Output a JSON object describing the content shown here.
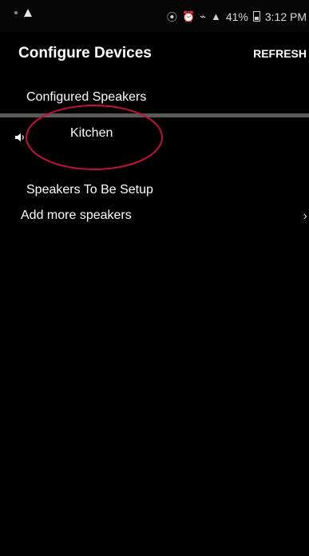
{
  "status_bar": {
    "battery": "41%",
    "time": "3:12 PM"
  },
  "header": {
    "title": "Configure Devices",
    "refresh_label": "REFRESH"
  },
  "configured_section": {
    "label": "Configured Speakers",
    "speakers": [
      {
        "name": "Kitchen",
        "icon": "speaker-volume-icon"
      }
    ]
  },
  "setup_section": {
    "label": "Speakers To Be Setup",
    "add_item_label": "Add more speakers",
    "add_item_chevron": "›"
  },
  "annotation_color": "#c4103a"
}
